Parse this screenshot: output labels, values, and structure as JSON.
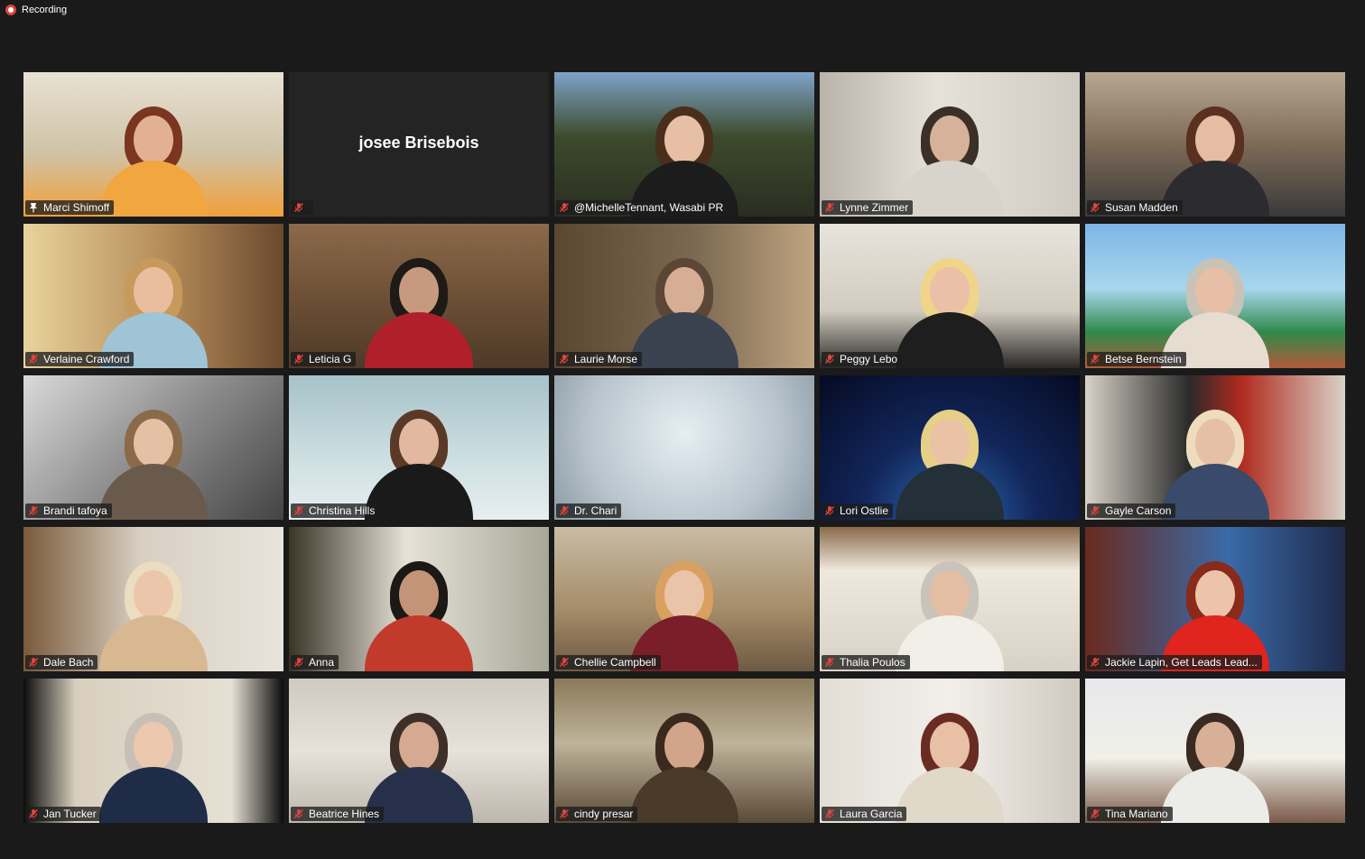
{
  "recording": {
    "label": "Recording",
    "color": "#e0443a"
  },
  "accent": {
    "active_speaker_border": "#c8ea2e",
    "muted_icon": "#e0443a"
  },
  "participants": [
    {
      "name": "Marci Shimoff",
      "muted": false,
      "active_speaker": true,
      "video": true,
      "icon": "pin-icon"
    },
    {
      "name": "josee Brisebois",
      "muted": true,
      "active_speaker": false,
      "video": false,
      "icon": "muted-mic-icon"
    },
    {
      "name": "@MichelleTennant, Wasabi PR",
      "muted": true,
      "active_speaker": false,
      "video": true,
      "icon": "muted-mic-icon"
    },
    {
      "name": "Lynne Zimmer",
      "muted": true,
      "active_speaker": false,
      "video": true,
      "icon": "muted-mic-icon"
    },
    {
      "name": "Susan Madden",
      "muted": true,
      "active_speaker": false,
      "video": true,
      "icon": "muted-mic-icon"
    },
    {
      "name": "Verlaine Crawford",
      "muted": true,
      "active_speaker": false,
      "video": true,
      "icon": "muted-mic-icon"
    },
    {
      "name": "Leticia G",
      "muted": true,
      "active_speaker": false,
      "video": true,
      "icon": "muted-mic-icon"
    },
    {
      "name": "Laurie Morse",
      "muted": true,
      "active_speaker": false,
      "video": true,
      "icon": "muted-mic-icon"
    },
    {
      "name": "Peggy Lebo",
      "muted": true,
      "active_speaker": false,
      "video": true,
      "icon": "muted-mic-icon"
    },
    {
      "name": "Betse Bernstein",
      "muted": true,
      "active_speaker": false,
      "video": true,
      "icon": "muted-mic-icon"
    },
    {
      "name": "Brandi tafoya",
      "muted": true,
      "active_speaker": false,
      "video": true,
      "icon": "muted-mic-icon"
    },
    {
      "name": "Christina Hills",
      "muted": true,
      "active_speaker": false,
      "video": true,
      "icon": "muted-mic-icon"
    },
    {
      "name": "Dr. Chari",
      "muted": true,
      "active_speaker": false,
      "video": true,
      "icon": "muted-mic-icon"
    },
    {
      "name": "Lori Ostlie",
      "muted": true,
      "active_speaker": false,
      "video": true,
      "icon": "muted-mic-icon"
    },
    {
      "name": "Gayle Carson",
      "muted": true,
      "active_speaker": false,
      "video": true,
      "icon": "muted-mic-icon"
    },
    {
      "name": "Dale Bach",
      "muted": true,
      "active_speaker": false,
      "video": true,
      "icon": "muted-mic-icon"
    },
    {
      "name": "Anna",
      "muted": true,
      "active_speaker": false,
      "video": true,
      "icon": "muted-mic-icon"
    },
    {
      "name": "Chellie Campbell",
      "muted": true,
      "active_speaker": false,
      "video": true,
      "icon": "muted-mic-icon"
    },
    {
      "name": "Thalia Poulos",
      "muted": true,
      "active_speaker": false,
      "video": true,
      "icon": "muted-mic-icon"
    },
    {
      "name": "Jackie Lapin, Get Leads Lead...",
      "muted": true,
      "active_speaker": false,
      "video": true,
      "icon": "muted-mic-icon"
    },
    {
      "name": "Jan Tucker",
      "muted": true,
      "active_speaker": false,
      "video": true,
      "icon": "muted-mic-icon"
    },
    {
      "name": "Beatrice Hines",
      "muted": true,
      "active_speaker": false,
      "video": true,
      "icon": "muted-mic-icon"
    },
    {
      "name": "cindy presar",
      "muted": true,
      "active_speaker": false,
      "video": true,
      "icon": "muted-mic-icon"
    },
    {
      "name": "Laura Garcia",
      "muted": true,
      "active_speaker": false,
      "video": true,
      "icon": "muted-mic-icon"
    },
    {
      "name": "Tina Mariano",
      "muted": true,
      "active_speaker": false,
      "video": true,
      "icon": "muted-mic-icon"
    }
  ]
}
